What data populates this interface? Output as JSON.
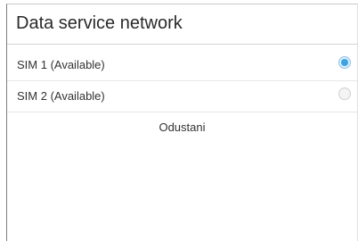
{
  "dialog": {
    "title": "Data service network",
    "options": [
      {
        "label": "SIM 1 (Available)",
        "selected": true
      },
      {
        "label": "SIM 2 (Available)",
        "selected": false
      }
    ],
    "cancel_label": "Odustani"
  },
  "colors": {
    "accent": "#3aa3e3",
    "text": "#333333",
    "divider": "#d3d3d3"
  }
}
